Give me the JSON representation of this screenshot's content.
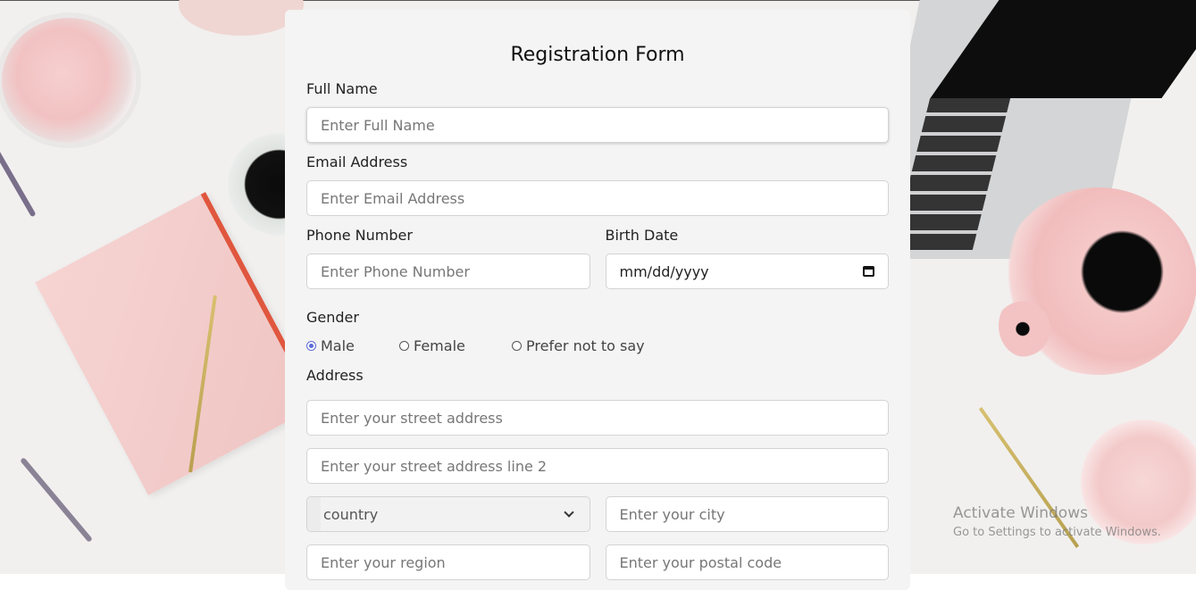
{
  "form": {
    "title": "Registration Form",
    "full_name": {
      "label": "Full Name",
      "placeholder": "Enter Full Name"
    },
    "email": {
      "label": "Email Address",
      "placeholder": "Enter Email Address"
    },
    "phone": {
      "label": "Phone Number",
      "placeholder": "Enter Phone Number"
    },
    "birth_date": {
      "label": "Birth Date",
      "placeholder": "mm/dd/yyyy",
      "icon": "calendar-icon"
    },
    "gender": {
      "label": "Gender",
      "options": [
        "Male",
        "Female",
        "Prefer not to say"
      ],
      "selected": "Male"
    },
    "address": {
      "label": "Address",
      "street": "Enter your street address",
      "street2": "Enter your street address line 2",
      "country": "country",
      "city": "Enter your city",
      "region": "Enter your region",
      "postal": "Enter your postal code"
    }
  },
  "watermark": {
    "title": "Activate Windows",
    "subtitle": "Go to Settings to activate Windows."
  },
  "colors": {
    "card_bg": "#f4f4f4",
    "radio_accent": "#5b6bd6"
  }
}
